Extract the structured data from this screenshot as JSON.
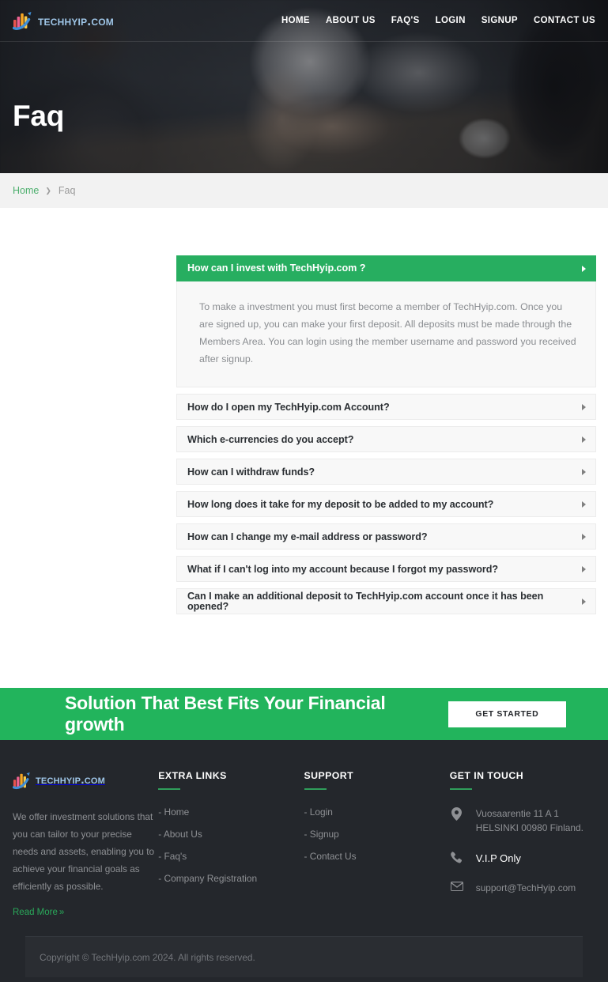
{
  "brand": {
    "name": "TechHyip.com",
    "logo_icon": "bar-chart-swoosh-logo",
    "accent_green": "#27ae60",
    "cta_green": "#22b45c",
    "footer_bg": "#24272c"
  },
  "nav": {
    "items": [
      {
        "label": "HOME",
        "name": "nav-home"
      },
      {
        "label": "ABOUT US",
        "name": "nav-about-us"
      },
      {
        "label": "FAQ'S",
        "name": "nav-faqs"
      },
      {
        "label": "LOGIN",
        "name": "nav-login"
      },
      {
        "label": "SIGNUP",
        "name": "nav-signup"
      },
      {
        "label": "CONTACT US",
        "name": "nav-contact-us"
      }
    ]
  },
  "hero": {
    "title": "Faq"
  },
  "breadcrumb": {
    "home": "Home",
    "separator": "❯",
    "current": "Faq"
  },
  "faq": {
    "items": [
      {
        "question": "How can I invest with TechHyip.com ?",
        "expanded": true,
        "answer": "To make a investment you must first become a member of TechHyip.com. Once you are signed up, you can make your first deposit. All deposits must be made through the Members Area. You can login using the member username and password you received after signup."
      },
      {
        "question": "How do I open my TechHyip.com Account?",
        "expanded": false,
        "answer": ""
      },
      {
        "question": "Which e-currencies do you accept?",
        "expanded": false,
        "answer": ""
      },
      {
        "question": "How can I withdraw funds?",
        "expanded": false,
        "answer": ""
      },
      {
        "question": "How long does it take for my deposit to be added to my account?",
        "expanded": false,
        "answer": ""
      },
      {
        "question": "How can I change my e-mail address or password?",
        "expanded": false,
        "answer": ""
      },
      {
        "question": "What if I can't log into my account because I forgot my password?",
        "expanded": false,
        "answer": ""
      },
      {
        "question": "Can I make an additional deposit to TechHyip.com account once it has been opened?",
        "expanded": false,
        "answer": ""
      }
    ]
  },
  "cta": {
    "headline": "Solution That Best Fits Your Financial growth",
    "button_label": "GET STARTED"
  },
  "footer": {
    "about": {
      "brand": "TechHyip.com",
      "text": "We offer investment solutions that you can tailor to your precise needs and assets, enabling you to achieve your financial goals as efficiently as possible.",
      "read_more": "Read More",
      "read_more_chevron": "»"
    },
    "extra_links": {
      "heading": "EXTRA LINKS",
      "items": [
        "- Home",
        "- About Us",
        "- Faq's",
        "- Company Registration"
      ]
    },
    "support": {
      "heading": "SUPPORT",
      "items": [
        "- Login",
        "- Signup",
        "- Contact Us"
      ]
    },
    "get_in_touch": {
      "heading": "GET IN TOUCH",
      "address_icon": "map-pin-icon",
      "address": "Vuosaarentie 11 A 1 HELSINKI 00980 Finland.",
      "phone_icon": "phone-icon",
      "phone": "V.I.P Only",
      "email_icon": "envelope-icon",
      "email": "support@TechHyip.com"
    },
    "copyright": "Copyright © TechHyip.com 2024. All rights reserved."
  }
}
